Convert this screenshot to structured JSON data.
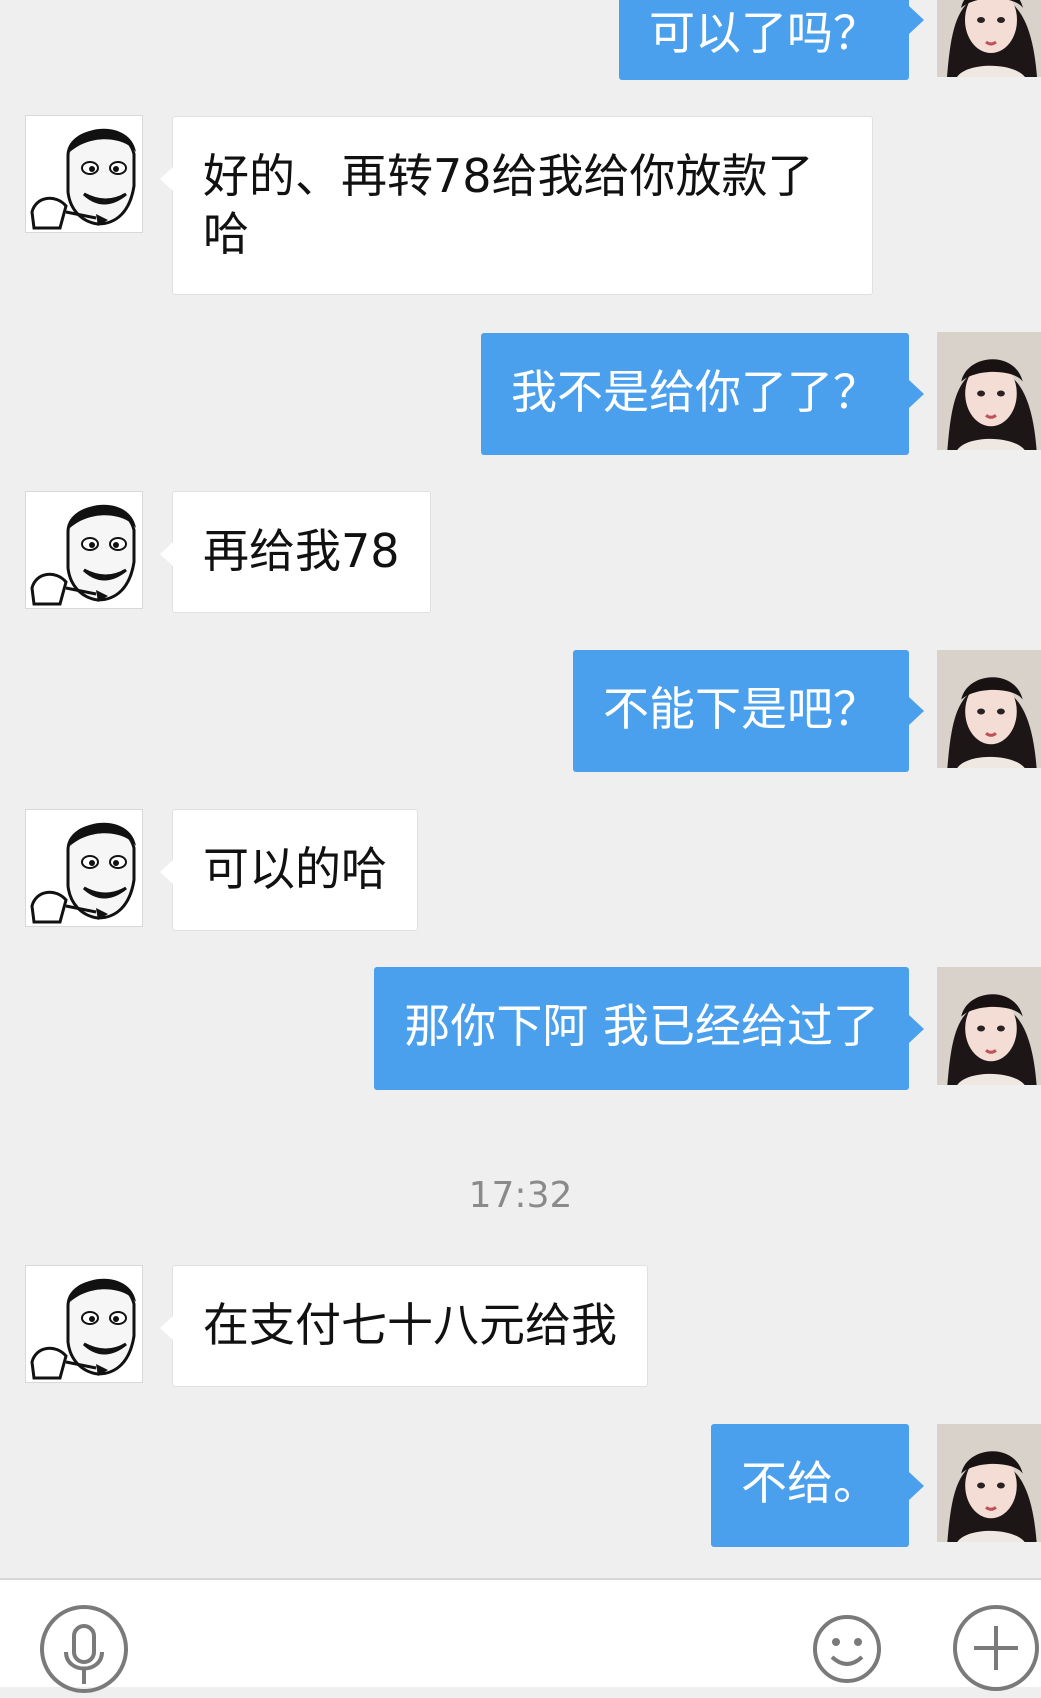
{
  "messages": [
    {
      "side": "out",
      "text": "可以了吗？"
    },
    {
      "side": "in",
      "text": "好的、再转78给我给你放款了哈"
    },
    {
      "side": "out",
      "text": "我不是给你了了？"
    },
    {
      "side": "in",
      "text": "再给我78"
    },
    {
      "side": "out",
      "text": "不能下是吧？"
    },
    {
      "side": "in",
      "text": "可以的哈"
    },
    {
      "side": "out",
      "text": "那你下阿 我已经给过了"
    },
    {
      "side": "in",
      "text": "在支付七十八元给我"
    },
    {
      "side": "out",
      "text": "不给。"
    }
  ],
  "timestamp": "17:32",
  "toolbar": {
    "voice_icon": "microphone-icon",
    "emoji_icon": "smiley-icon",
    "more_icon": "plus-icon"
  },
  "colors": {
    "outgoing_bubble": "#4ba0ee",
    "incoming_bubble": "#ffffff",
    "background": "#efefef"
  },
  "avatars": {
    "contact": "cartoon-man-avatar",
    "self": "woman-photo-avatar"
  }
}
